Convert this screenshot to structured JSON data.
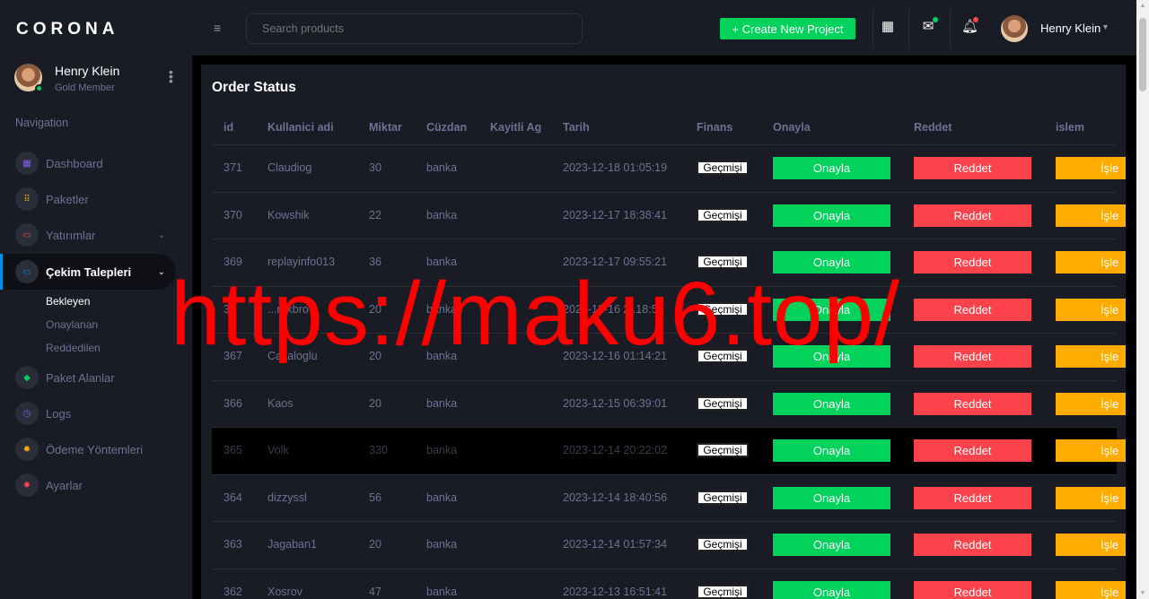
{
  "brand": "CORONA",
  "profile": {
    "name": "Henry Klein",
    "role": "Gold Member"
  },
  "nav": {
    "title": "Navigation",
    "items": [
      {
        "label": "Dashboard",
        "icon": "dashboard-icon",
        "color": "#8f5fe8"
      },
      {
        "label": "Paketler",
        "icon": "grid-icon",
        "color": "#ffab00"
      },
      {
        "label": "Yatırımlar",
        "icon": "laptop-icon",
        "color": "#fc424a"
      },
      {
        "label": "Çekim Talepleri",
        "icon": "laptop-icon",
        "color": "#0090e7"
      },
      {
        "label": "Paket Alanlar",
        "icon": "cube-icon",
        "color": "#00d25b"
      },
      {
        "label": "Logs",
        "icon": "history-icon",
        "color": "#8f5fe8"
      },
      {
        "label": "Ödeme Yöntemleri",
        "icon": "gear-icon",
        "color": "#ffab00"
      },
      {
        "label": "Ayarlar",
        "icon": "gear-icon",
        "color": "#fc424a"
      }
    ],
    "sub_items": [
      "Bekleyen",
      "Onaylanan",
      "Reddedilen"
    ]
  },
  "navbar": {
    "search_placeholder": "Search products",
    "create_label": "+ Create New Project",
    "user_name": "Henry Klein"
  },
  "card": {
    "title": "Order Status"
  },
  "table": {
    "headers": [
      "id",
      "Kullanici adi",
      "Miktar",
      "Cüzdan",
      "Kayitli Ag",
      "Tarih",
      "Finans",
      "Onayla",
      "Reddet",
      "islem"
    ],
    "rows": [
      {
        "id": "371",
        "user": "Claudiog",
        "amount": "30",
        "wallet": "banka",
        "date": "2023-12-18 01:05:19"
      },
      {
        "id": "370",
        "user": "Kowshik",
        "amount": "22",
        "wallet": "banka",
        "date": "2023-12-17 18:38:41"
      },
      {
        "id": "369",
        "user": "replayinfo013",
        "amount": "36",
        "wallet": "banka",
        "date": "2023-12-17 09:55:21"
      },
      {
        "id": "36",
        "user": "...rekbro",
        "amount": "20",
        "wallet": "banka",
        "date": "2023-12-16 2..18:56"
      },
      {
        "id": "367",
        "user": "Cakaloglu",
        "amount": "20",
        "wallet": "banka",
        "date": "2023-12-16 01:14:21"
      },
      {
        "id": "366",
        "user": "Kaos",
        "amount": "20",
        "wallet": "banka",
        "date": "2023-12-15 06:39:01"
      },
      {
        "id": "365",
        "user": "Volk",
        "amount": "330",
        "wallet": "banka",
        "date": "2023-12-14 20:22:02"
      },
      {
        "id": "364",
        "user": "dizzyssl",
        "amount": "56",
        "wallet": "banka",
        "date": "2023-12-14 18:40:56"
      },
      {
        "id": "363",
        "user": "Jagaban1",
        "amount": "20",
        "wallet": "banka",
        "date": "2023-12-14 01:57:34"
      },
      {
        "id": "362",
        "user": "Xosrov",
        "amount": "47",
        "wallet": "banka",
        "date": "2023-12-13 16:51:41"
      }
    ],
    "history_label": "Geçmişi",
    "approve_label": "Onayla",
    "reject_label": "Reddet",
    "process_label": "İşle"
  },
  "watermark": "https://maku6.top/"
}
